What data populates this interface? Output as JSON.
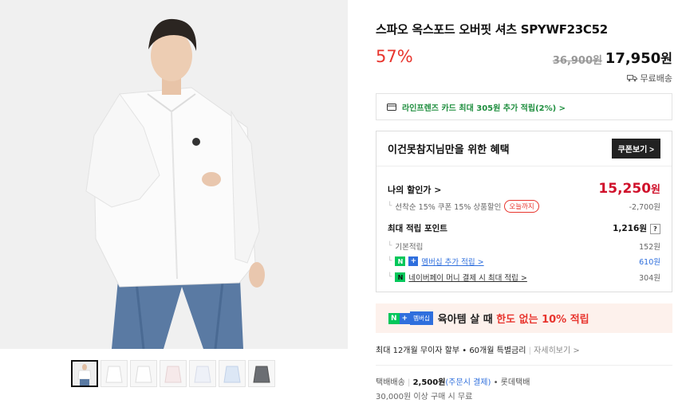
{
  "gallery": {
    "thumbnail_count": 7,
    "active_index": 0
  },
  "product": {
    "title": "스파오 옥스포드 오버핏 셔츠 SPYWF23C52",
    "discount_rate": "57%",
    "original_price": "36,900원",
    "sale_price": "17,950",
    "sale_unit": "원",
    "shipping_label": "무료배송"
  },
  "card_promo": {
    "text": "라인프렌즈 카드 최대 305원 추가 적립(2%) >"
  },
  "benefit": {
    "title": "이건못참지님만을 위한 혜택",
    "coupon_button": "쿠폰보기 >",
    "my_discount_label": "나의 할인가 >",
    "my_discount_price": "15,250",
    "my_discount_unit": "원",
    "coupon_detail": "선착순 15% 쿠폰 15% 상품할인",
    "coupon_badge": "오늘까지",
    "coupon_amount": "-2,700원",
    "points_label": "최대 적립 포인트",
    "points_total": "1,216원",
    "points_help": "?",
    "basic_label": "기본적립",
    "basic_value": "152원",
    "membership_label": "멤버십 추가 적립 >",
    "membership_value": "610원",
    "npay_label": "네이버페이 머니 결제 시 최대 적립 >",
    "npay_value": "304원"
  },
  "promo_banner": {
    "n_badge": "N",
    "plus_badge": "+",
    "member_badge": "멤버십",
    "text_prefix": "육아템 살 때 ",
    "text_highlight": "한도 없는 10% 적립"
  },
  "installment": {
    "text": "최대 12개월 무이자 할부 • 60개월 특별금리",
    "more": "자세히보기 >"
  },
  "delivery": {
    "label": "택배배송",
    "fee": "2,500원",
    "fee_note": "(주문시 결제)",
    "carrier": "• 롯데택배",
    "free_condition": "30,000원 이상 구매 시 무료"
  },
  "colors": {
    "accent_red": "#e8352e",
    "price_red": "#d0112b",
    "naver_green": "#03c75a",
    "link_blue": "#2f6fdd"
  }
}
